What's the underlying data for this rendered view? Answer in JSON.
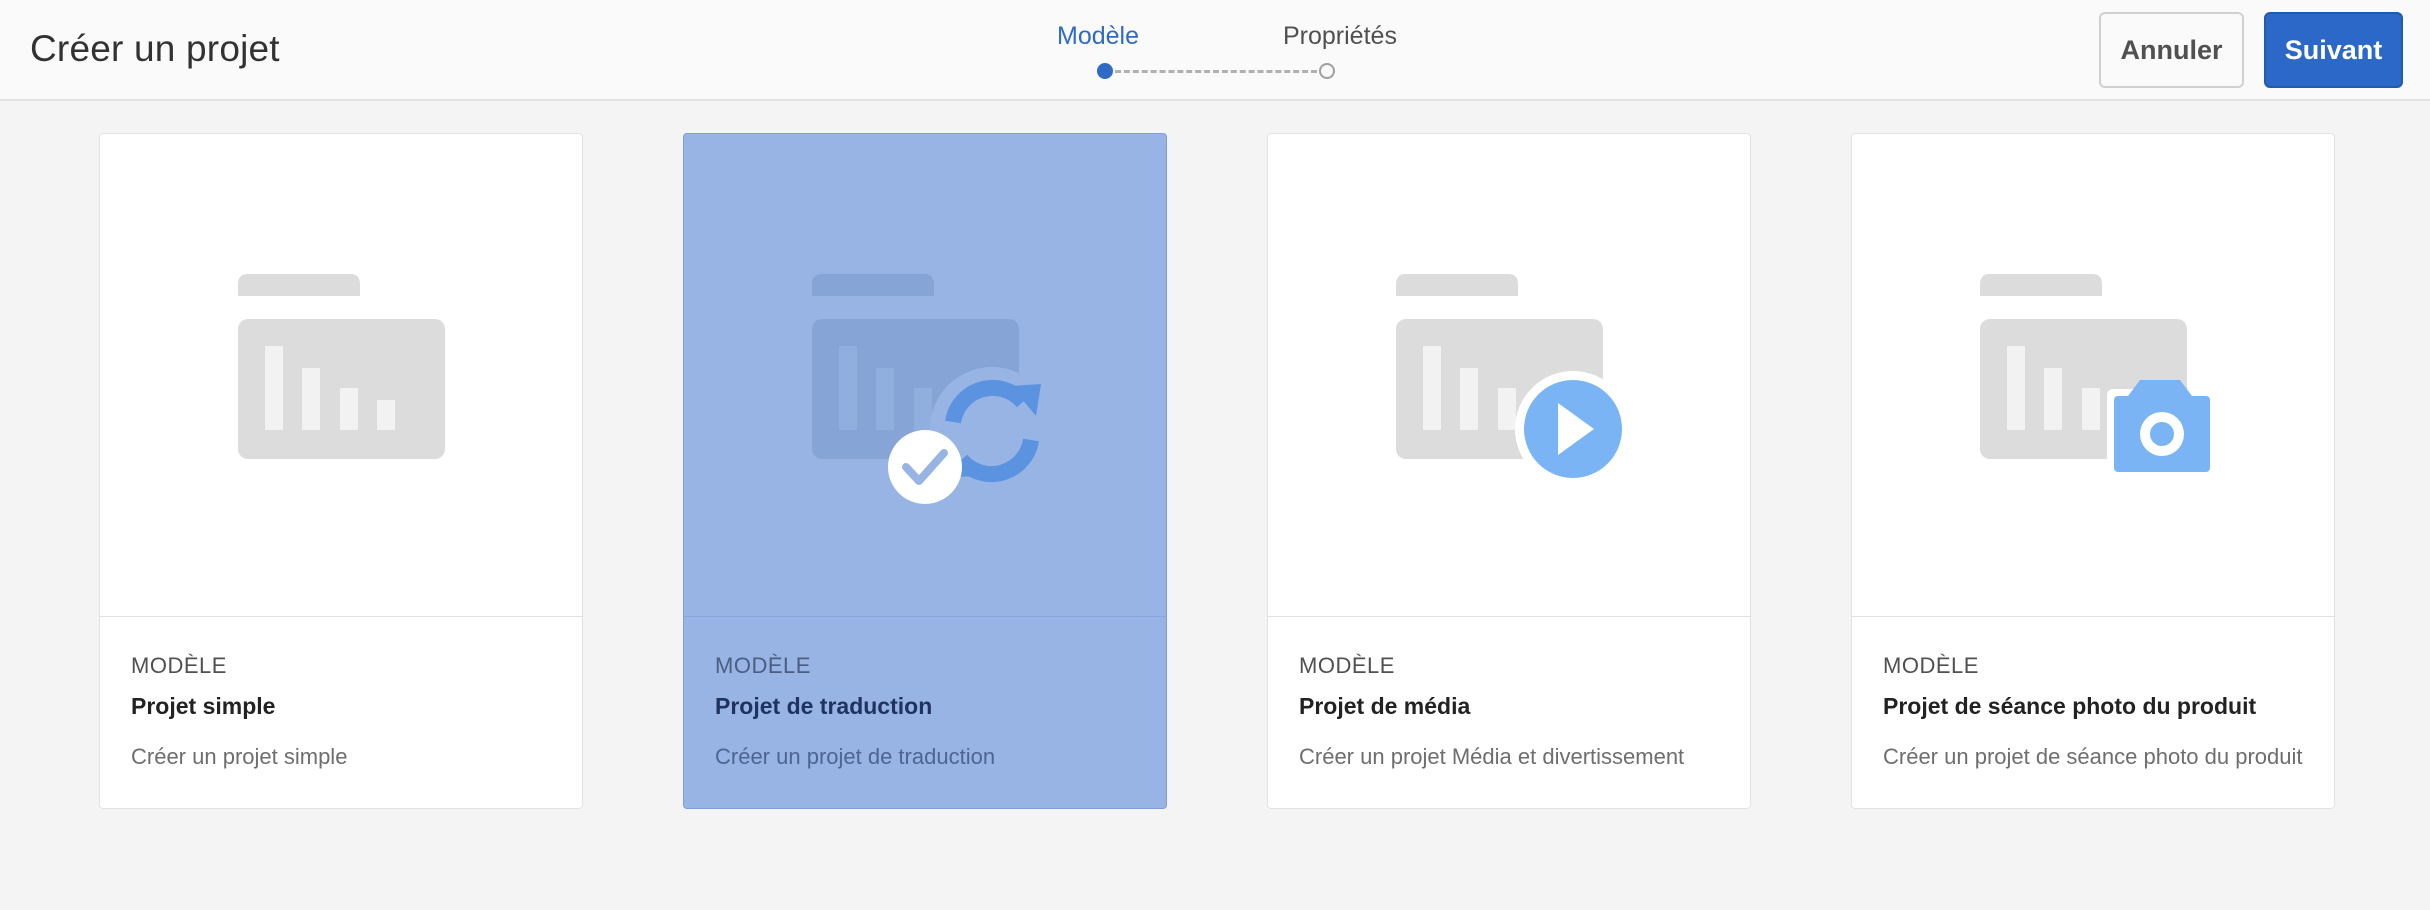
{
  "header": {
    "title": "Créer un projet",
    "steps": [
      {
        "label": "Modèle",
        "state": "active"
      },
      {
        "label": "Propriétés",
        "state": "pending"
      }
    ],
    "cancel_label": "Annuler",
    "next_label": "Suivant"
  },
  "cards": [
    {
      "type_label": "MODÈLE",
      "title": "Projet simple",
      "description": "Créer un projet simple",
      "icon": "folder-chart-icon",
      "selected": false
    },
    {
      "type_label": "MODÈLE",
      "title": "Projet de traduction",
      "description": "Créer un projet de traduction",
      "icon": "folder-sync-icon",
      "selected": true
    },
    {
      "type_label": "MODÈLE",
      "title": "Projet de média",
      "description": "Créer un projet Média et divertissement",
      "icon": "folder-play-icon",
      "selected": false
    },
    {
      "type_label": "MODÈLE",
      "title": "Projet de séance photo du produit",
      "description": "Créer un projet de séance photo du produit",
      "icon": "folder-camera-icon",
      "selected": false
    }
  ],
  "colors": {
    "accent": "#2c68c8",
    "selected_card": "#97b4e4",
    "icon_blue": "#6ea8ee",
    "placeholder_gray": "#dcdcdc"
  }
}
